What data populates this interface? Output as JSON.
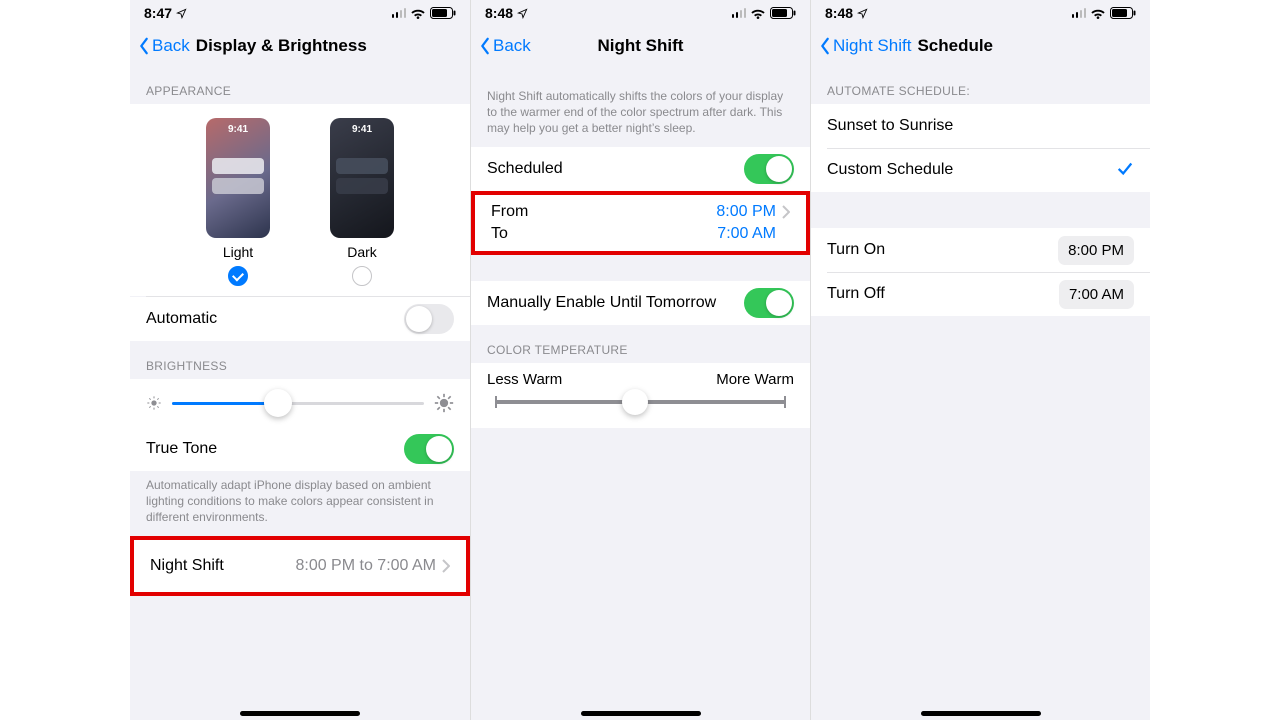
{
  "status": {
    "time1": "8:47",
    "time2": "8:48",
    "time3": "8:48"
  },
  "s1": {
    "back": "Back",
    "title": "Display & Brightness",
    "appearance_header": "APPEARANCE",
    "preview_time": "9:41",
    "light_label": "Light",
    "dark_label": "Dark",
    "automatic": "Automatic",
    "automatic_on": false,
    "brightness_header": "BRIGHTNESS",
    "true_tone": "True Tone",
    "true_tone_on": true,
    "true_tone_note": "Automatically adapt iPhone display based on ambient lighting conditions to make colors appear consistent in different environments.",
    "night_shift": "Night Shift",
    "night_shift_detail": "8:00 PM to 7:00 AM"
  },
  "s2": {
    "back": "Back",
    "title": "Night Shift",
    "intro": "Night Shift automatically shifts the colors of your display to the warmer end of the color spectrum after dark. This may help you get a better night’s sleep.",
    "scheduled": "Scheduled",
    "scheduled_on": true,
    "from_label": "From",
    "to_label": "To",
    "from_value": "8:00 PM",
    "to_value": "7:00 AM",
    "manual": "Manually Enable Until Tomorrow",
    "manual_on": true,
    "color_temp_header": "COLOR TEMPERATURE",
    "less_warm": "Less Warm",
    "more_warm": "More Warm"
  },
  "s3": {
    "back": "Night Shift",
    "title": "Schedule",
    "header": "AUTOMATE SCHEDULE:",
    "sunset": "Sunset to Sunrise",
    "custom": "Custom Schedule",
    "turn_on": "Turn On",
    "turn_on_value": "8:00 PM",
    "turn_off": "Turn Off",
    "turn_off_value": "7:00 AM"
  }
}
